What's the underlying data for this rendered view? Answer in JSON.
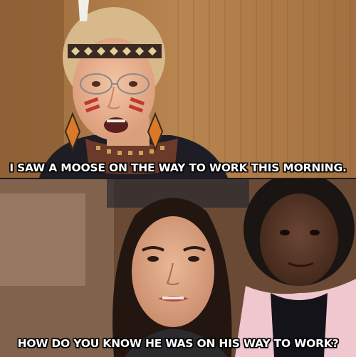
{
  "meme": {
    "top_caption": "I SAW A MOOSE ON THE WAY TO WORK THIS MORNING.",
    "bottom_caption": "HOW DO YOU KNOW HE WAS ON HIS WAY TO WORK?"
  },
  "colors": {
    "caption_text": "#ffffff",
    "caption_outline": "#000000",
    "top_background": "#b07a45",
    "bottom_background": "#6a4a35"
  }
}
